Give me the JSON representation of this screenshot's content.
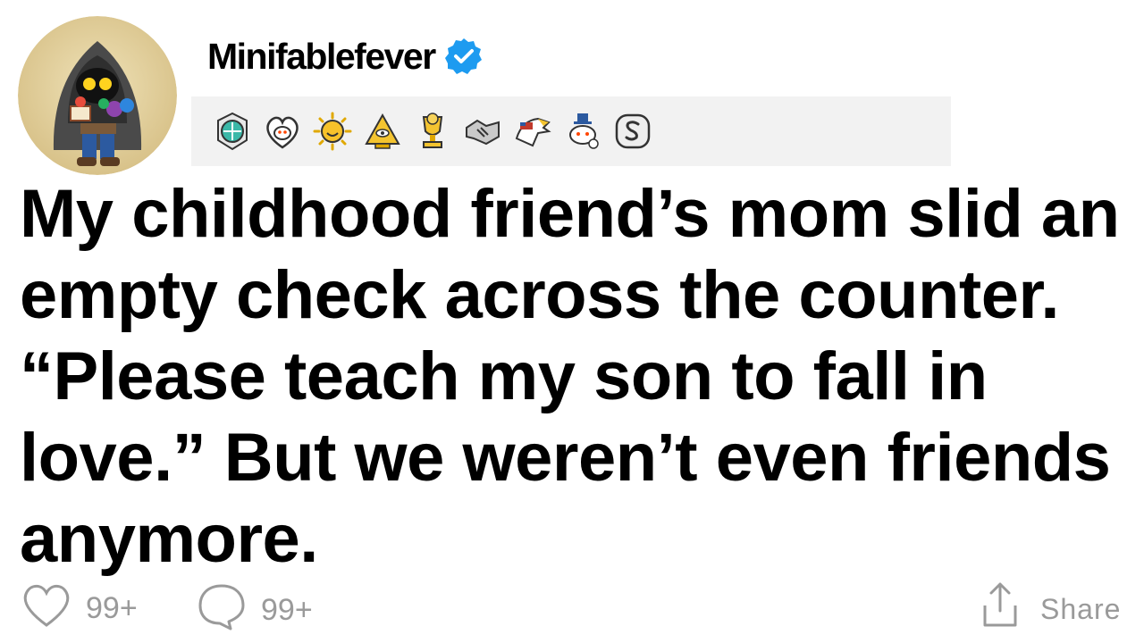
{
  "post": {
    "username": "Minifablefever",
    "verified": true,
    "title": "My childhood friend’s mom slid an empty check across the counter. “Please teach my son to fall in love.” But we weren’t even friends anymore."
  },
  "awards": [
    {
      "name": "gem-award-icon"
    },
    {
      "name": "heart-snoo-award-icon"
    },
    {
      "name": "sun-award-icon"
    },
    {
      "name": "pyramid-eye-award-icon"
    },
    {
      "name": "trophy-award-icon"
    },
    {
      "name": "handshake-award-icon"
    },
    {
      "name": "eagle-award-icon"
    },
    {
      "name": "snoo-hat-award-icon"
    },
    {
      "name": "silver-s-award-icon"
    }
  ],
  "actions": {
    "likes": "99+",
    "comments": "99+",
    "share_label": "Share"
  },
  "colors": {
    "verified": "#1d9bf0",
    "muted": "#9a9a9a",
    "awards_background": "#f2f2f2"
  }
}
